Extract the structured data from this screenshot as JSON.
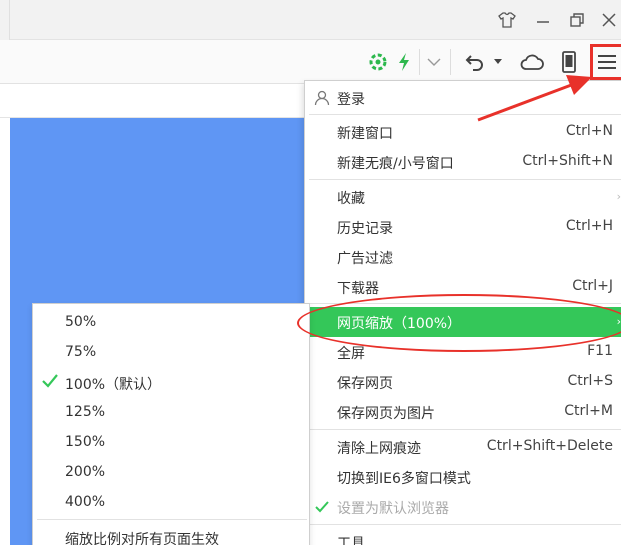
{
  "menu": {
    "login": "登录",
    "items": [
      {
        "label": "新建窗口",
        "shortcut": "Ctrl+N"
      },
      {
        "label": "新建无痕/小号窗口",
        "shortcut": "Ctrl+Shift+N"
      },
      {
        "label": "收藏",
        "shortcut": ""
      },
      {
        "label": "历史记录",
        "shortcut": "Ctrl+H"
      },
      {
        "label": "广告过滤",
        "shortcut": ""
      },
      {
        "label": "下载器",
        "shortcut": "Ctrl+J"
      },
      {
        "label": "网页缩放（100%）",
        "shortcut": ""
      },
      {
        "label": "全屏",
        "shortcut": "F11"
      },
      {
        "label": "保存网页",
        "shortcut": "Ctrl+S"
      },
      {
        "label": "保存网页为图片",
        "shortcut": "Ctrl+M"
      },
      {
        "label": "清除上网痕迹",
        "shortcut": "Ctrl+Shift+Delete"
      },
      {
        "label": "切换到IE6多窗口模式",
        "shortcut": ""
      },
      {
        "label": "设置为默认浏览器",
        "shortcut": ""
      },
      {
        "label": "工具",
        "shortcut": ""
      }
    ]
  },
  "zoom_menu": {
    "options": [
      "50%",
      "75%",
      "100%（默认）",
      "125%",
      "150%",
      "200%",
      "400%"
    ],
    "selected": "100%（默认）",
    "apply_all": "缩放比例对所有页面生效"
  },
  "colors": {
    "highlight": "#34c759",
    "annotation": "#e8312a",
    "page_background": "#5f96f4"
  },
  "icons": {
    "titlebar": [
      "skin-icon",
      "minimize-icon",
      "restore-icon",
      "close-icon"
    ],
    "toolbar": [
      "speed-icon",
      "lightning-icon",
      "dropdown-chevron-icon",
      "undo-icon",
      "cloud-icon",
      "phone-icon",
      "hamburger-menu-icon"
    ]
  }
}
